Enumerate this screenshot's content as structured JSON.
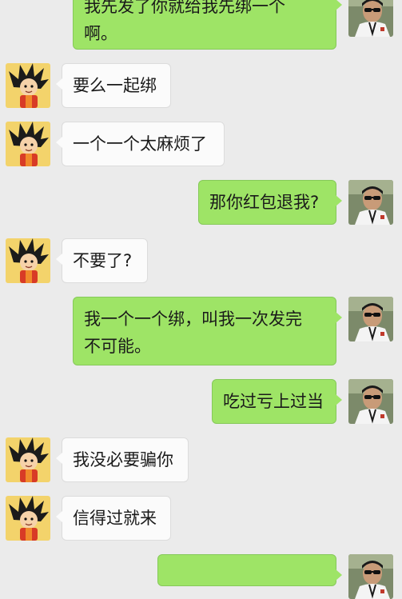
{
  "colors": {
    "background": "#ebebeb",
    "incoming_bubble": "#fbfbfb",
    "outgoing_bubble": "#9ee466"
  },
  "avatars": {
    "incoming": "goku-cartoon-avatar",
    "outgoing": "man-with-sunglasses-photo-avatar"
  },
  "messages": [
    {
      "side": "outgoing",
      "text": "我先发了你就给我先绑一个\n啊。"
    },
    {
      "side": "incoming",
      "text": "要么一起绑"
    },
    {
      "side": "incoming",
      "text": "一个一个太麻烦了"
    },
    {
      "side": "outgoing",
      "text": "那你红包退我?"
    },
    {
      "side": "incoming",
      "text": "不要了?"
    },
    {
      "side": "outgoing",
      "text": "我一个一个绑，叫我一次发完\n不可能。"
    },
    {
      "side": "outgoing",
      "text": "吃过亏上过当"
    },
    {
      "side": "incoming",
      "text": "我没必要骗你"
    },
    {
      "side": "incoming",
      "text": "信得过就来"
    },
    {
      "side": "outgoing",
      "text": ""
    }
  ]
}
